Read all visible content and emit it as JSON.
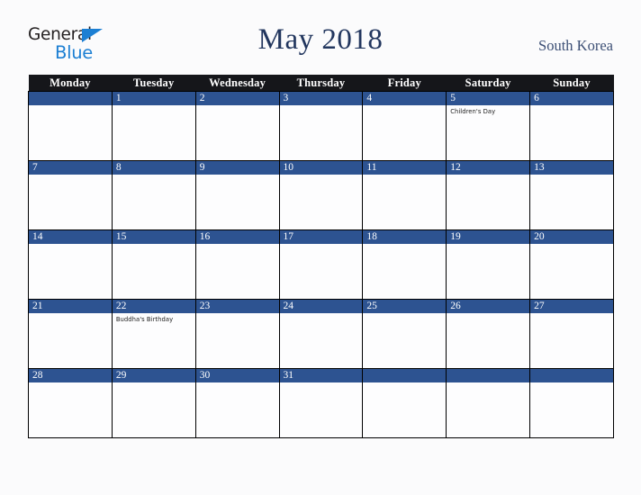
{
  "brand": {
    "word_one": "General",
    "word_two": "Blue",
    "triangle_color": "#1c7fd3",
    "text_color": "#231f20"
  },
  "header": {
    "title": "May 2018",
    "region": "South Korea",
    "title_color": "#22365e",
    "region_color": "#3c4f75"
  },
  "calendar": {
    "accent_color": "#2d5391",
    "header_bg": "#15161a",
    "weekday_headers": [
      "Monday",
      "Tuesday",
      "Wednesday",
      "Thursday",
      "Friday",
      "Saturday",
      "Sunday"
    ],
    "weeks": [
      [
        {
          "day": "",
          "events": []
        },
        {
          "day": "1",
          "events": []
        },
        {
          "day": "2",
          "events": []
        },
        {
          "day": "3",
          "events": []
        },
        {
          "day": "4",
          "events": []
        },
        {
          "day": "5",
          "events": [
            "Children's Day"
          ]
        },
        {
          "day": "6",
          "events": []
        }
      ],
      [
        {
          "day": "7",
          "events": []
        },
        {
          "day": "8",
          "events": []
        },
        {
          "day": "9",
          "events": []
        },
        {
          "day": "10",
          "events": []
        },
        {
          "day": "11",
          "events": []
        },
        {
          "day": "12",
          "events": []
        },
        {
          "day": "13",
          "events": []
        }
      ],
      [
        {
          "day": "14",
          "events": []
        },
        {
          "day": "15",
          "events": []
        },
        {
          "day": "16",
          "events": []
        },
        {
          "day": "17",
          "events": []
        },
        {
          "day": "18",
          "events": []
        },
        {
          "day": "19",
          "events": []
        },
        {
          "day": "20",
          "events": []
        }
      ],
      [
        {
          "day": "21",
          "events": []
        },
        {
          "day": "22",
          "events": [
            "Buddha's Birthday"
          ]
        },
        {
          "day": "23",
          "events": []
        },
        {
          "day": "24",
          "events": []
        },
        {
          "day": "25",
          "events": []
        },
        {
          "day": "26",
          "events": []
        },
        {
          "day": "27",
          "events": []
        }
      ],
      [
        {
          "day": "28",
          "events": []
        },
        {
          "day": "29",
          "events": []
        },
        {
          "day": "30",
          "events": []
        },
        {
          "day": "31",
          "events": []
        },
        {
          "day": "",
          "events": []
        },
        {
          "day": "",
          "events": []
        },
        {
          "day": "",
          "events": []
        }
      ]
    ]
  }
}
